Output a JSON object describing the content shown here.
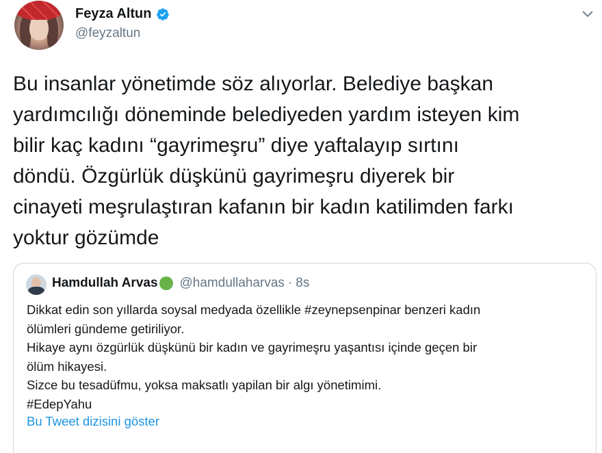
{
  "tweet": {
    "author": {
      "name": "Feyza Altun",
      "handle": "@feyzaltun",
      "verified": true
    },
    "text_lines": [
      "Bu insanlar yönetimde söz alıyorlar. Belediye başkan",
      "yardımcılığı döneminde belediyeden yardım isteyen kim",
      "bilir kaç kadını “gayrimeşru” diye yaftalayıp sırtını",
      "döndü. Özgürlük düşkünü gayrimeşru diyerek bir",
      "cinayeti meşrulaştıran kafanın bir kadın katilimden farkı",
      "yoktur gözümde"
    ]
  },
  "quoted_tweet": {
    "author": {
      "name": "Hamdullah Arvas",
      "handle": "@hamdullaharvas",
      "separator": "·",
      "time": "8s"
    },
    "text_lines": [
      "Dikkat edin son yıllarda soysal medyada özellikle #zeynepsenpinar benzeri kadın",
      "ölümleri gündeme getiriliyor.",
      "Hikaye aynı özgürlük düşkünü bir kadın ve gayrimeşru yaşantısı içinde geçen bir",
      "ölüm hikayesi.",
      "Sizce bu tesadüfmu, yoksa maksatlı yapilan bir algı yönetimimi.",
      "#EdepYahu"
    ],
    "thread_link": "Bu Tweet dizisini göster"
  },
  "icons": {
    "verified": "verified-badge-icon",
    "caret": "chevron-down-icon",
    "status": "green-circle-emoji"
  },
  "colors": {
    "link": "#1b95e0",
    "secondary_text": "#657786",
    "verified": "#1da1f2",
    "border": "#ccd6dd"
  }
}
